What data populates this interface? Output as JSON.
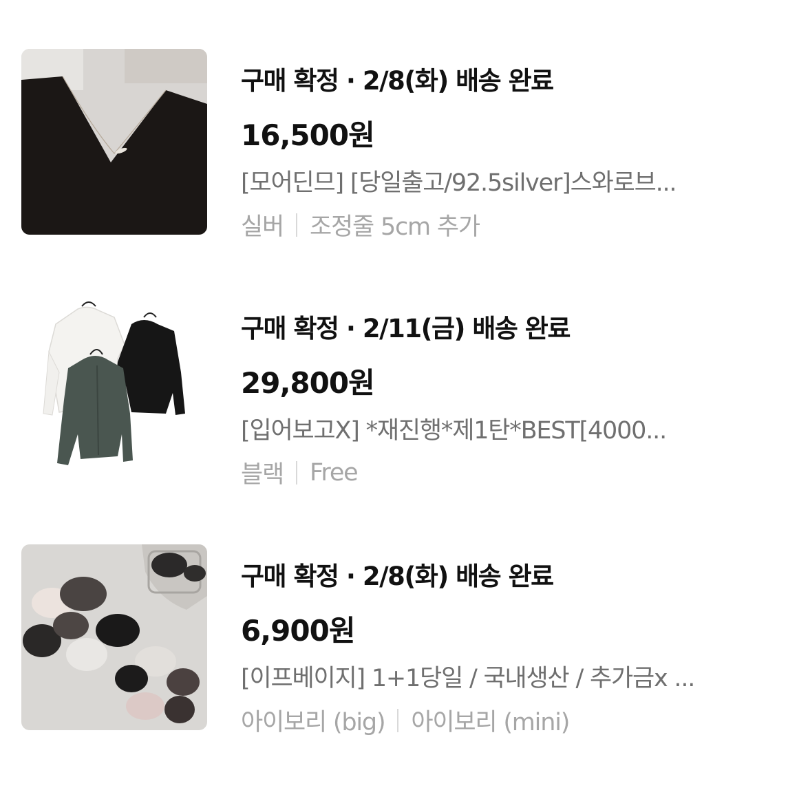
{
  "orders": [
    {
      "status": "구매 확정 · 2/8(화) 배송 완료",
      "price": "16,500원",
      "product_name": "[모어딘므] [당일출고/92.5silver]스와로브...",
      "options": [
        "실버",
        "조정줄 5cm 추가"
      ],
      "thumbnail": "necklace-photo"
    },
    {
      "status": "구매 확정 · 2/11(금) 배송 완료",
      "price": "29,800원",
      "product_name": "[입어보고X] *재진행*제1탄*BEST[4000...",
      "options": [
        "블랙",
        "Free"
      ],
      "thumbnail": "shirts-photo"
    },
    {
      "status": "구매 확정 · 2/8(화) 배송 완료",
      "price": "6,900원",
      "product_name": "[이프베이지] 1+1당일 / 국내생산 / 추가금x ...",
      "options": [
        "아이보리 (big)",
        "아이보리 (mini)"
      ],
      "thumbnail": "scrunchies-photo"
    }
  ]
}
